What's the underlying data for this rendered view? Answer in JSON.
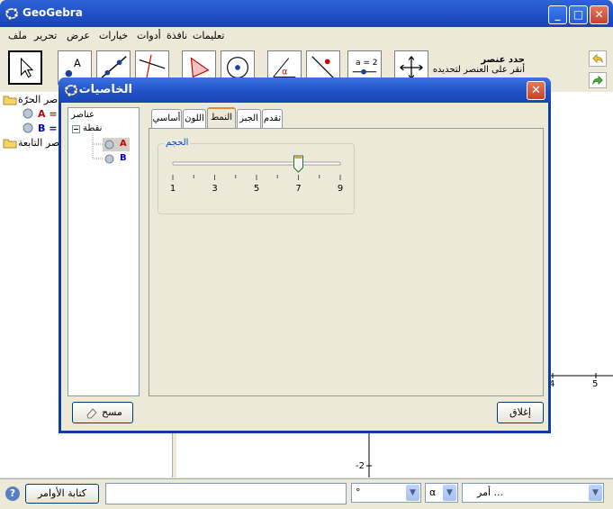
{
  "window": {
    "title": "GeoGebra",
    "min": "_",
    "max": "□",
    "close": "✕"
  },
  "menu": [
    "ملف",
    "تحرير",
    "عرض",
    "خيارات",
    "أدوات",
    "نافذة",
    "تعليمات"
  ],
  "toolbar": {
    "tools": [
      "move-tool",
      "point-tool",
      "line-tool",
      "perpendicular-tool",
      "polygon-tool",
      "circle-tool",
      "angle-tool",
      "reflect-tool",
      "slider-tool",
      "move-view-tool"
    ],
    "slider_tool_text": "a = 2",
    "hint_title": "حدد عنصر",
    "hint_text": "أنقر على العنصر لتحديده"
  },
  "algebra": {
    "free_folder": "عناصر الحرّة",
    "items": [
      {
        "text": "A = (",
        "color": "#cc0000"
      },
      {
        "text": "B = (",
        "color": "#0000cc"
      }
    ],
    "dependent_folder": "عناصر التابعة"
  },
  "graphics": {
    "x_labels": [
      "4",
      "5"
    ],
    "y_labels": [
      "-2"
    ]
  },
  "dialog": {
    "title": "الخاصيات",
    "tree": {
      "root": "عناصر",
      "group": "نقطة",
      "items": [
        "A",
        "B"
      ]
    },
    "tabs": [
      "أساسي",
      "اللون",
      "النمط",
      "الجبر",
      "تقدم"
    ],
    "active_tab": "النمط",
    "size_group": {
      "label": "الحجم",
      "value": 7,
      "min": 1,
      "max": 9,
      "tick_labels": [
        "1",
        "3",
        "5",
        "7",
        "9"
      ]
    },
    "delete_button": "مسح",
    "close_button": "إغلاق"
  },
  "bottom": {
    "input_help_button": "كتابة الأوامر",
    "symbol_combo": "°",
    "greek_combo": "α",
    "command_combo": "أمر ..."
  },
  "colors": {
    "title_blue": "#1f4fc5",
    "point_a": "#cc0000",
    "point_b": "#0000cc",
    "group_label": "#0046d5"
  }
}
